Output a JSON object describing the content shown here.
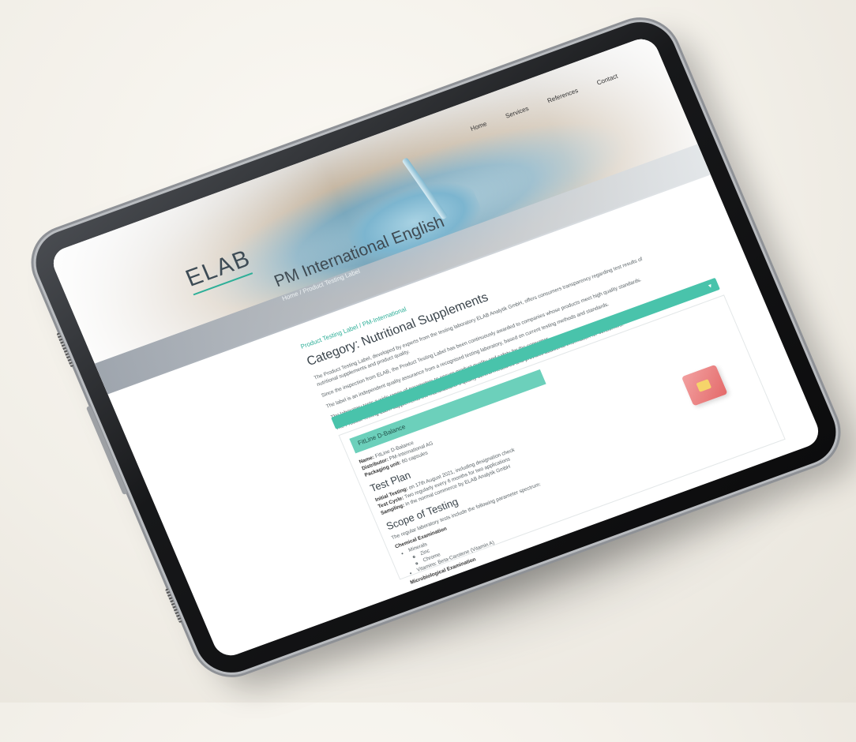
{
  "site": {
    "logo": "ELAB",
    "nav": [
      "Home",
      "Services",
      "References",
      "Contact"
    ],
    "hero_title": "PM International English",
    "hero_subtitle": "Home / Product Testing Label"
  },
  "content": {
    "breadcrumb": "Product Testing Label / PM-International",
    "category_title": "Category: Nutritional Supplements",
    "paragraphs": [
      "The Product Testing Label, developed by experts from the testing laboratory ELAB Analytik GmbH, offers consumers transparency regarding test results of nutritional supplements and product quality.",
      "Since the inspection from ELAB, the Product Testing Label has been continuously awarded to companies whose products meet high quality standards.",
      "The label is an independent quality assurance from a recognised testing laboratory, based on current testing methods and standards.",
      "The laboratory tests a wide range of parameters to ensure product quality and safety for the consumer.",
      "The Product Testing Label supplements the manufacturer's quality control measures and provides additional information for consumers."
    ]
  },
  "accordion": {
    "caret": "▾"
  },
  "panel": {
    "heading": "FitLine D-Balance",
    "fields": [
      {
        "label": "Name:",
        "value": "FitLine D-Balance"
      },
      {
        "label": "Distributor:",
        "value": "PM-International AG"
      },
      {
        "label": "Packaging unit:",
        "value": "60 capsules"
      }
    ],
    "test_plan_title": "Test Plan",
    "test_plan": [
      {
        "label": "Initial Testing:",
        "value": "on 17th August 2021, including designation check"
      },
      {
        "label": "Test Cycle:",
        "value": "Two regularly every 6 months for two applications"
      },
      {
        "label": "Sampling:",
        "value": "in the normal commerce by ELAB Analytik GmbH"
      }
    ],
    "scope_title": "Scope of Testing",
    "scope_intro": "The regular laboratory tests include the following parameter spectrum:",
    "chem_heading": "Chemical Examination",
    "chem_items": [
      "Minerals"
    ],
    "chem_sub": [
      "Zinc",
      "Chrome"
    ],
    "chem_items_2": [
      "Vitamins: Beta-Carotene (Vitamin A)"
    ],
    "micro_heading": "Microbiological Examination"
  }
}
